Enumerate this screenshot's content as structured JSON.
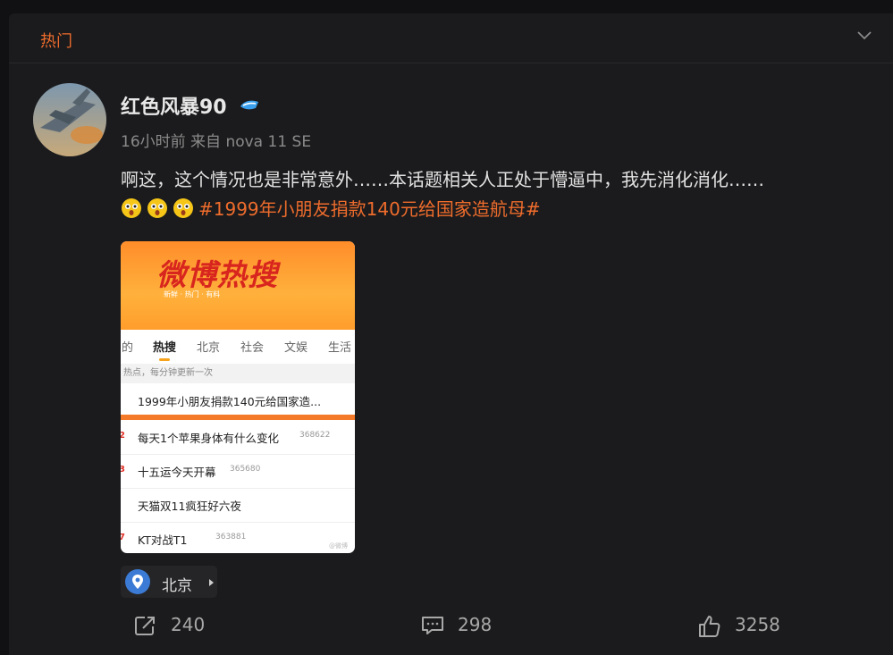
{
  "header": {
    "tab_label": "热门"
  },
  "post": {
    "username": "红色风暴90",
    "time": "16小时前",
    "source": "来自 nova 11 SE",
    "text": "啊这，这个情况也是非常意外……本话题相关人正处于懵逼中，我先消化消化……",
    "hashtag": "#1999年小朋友捐款140元给国家造航母#",
    "location": "北京"
  },
  "thumbnail": {
    "logo": "微博热搜",
    "slogan": "新鲜 · 热门 · 有料",
    "tabs": [
      "的",
      "热搜",
      "北京",
      "社会",
      "文娱",
      "生活"
    ],
    "note": "热点，每分钟更新一次",
    "rows": [
      {
        "rank": "",
        "title": "1999年小朋友捐款140元给国家造...",
        "count": ""
      },
      {
        "rank": "2",
        "title": "每天1个苹果身体有什么变化",
        "count": "368622"
      },
      {
        "rank": "3",
        "title": "十五运今天开幕",
        "count": "365680"
      },
      {
        "rank": "",
        "title": "天猫双11疯狂好六夜",
        "count": ""
      },
      {
        "rank": "7",
        "title": "KT对战T1",
        "count": "363881"
      }
    ],
    "watermark": "@微博"
  },
  "actions": {
    "repost": "240",
    "comment": "298",
    "like": "3258"
  },
  "colors": {
    "accent": "#ee6c2c",
    "background": "#1b1b1d"
  },
  "icons": [
    "chevron-down-icon",
    "vip-badge-icon",
    "surprised-emoji-icon",
    "location-pin-icon",
    "repost-icon",
    "comment-icon",
    "like-icon"
  ]
}
